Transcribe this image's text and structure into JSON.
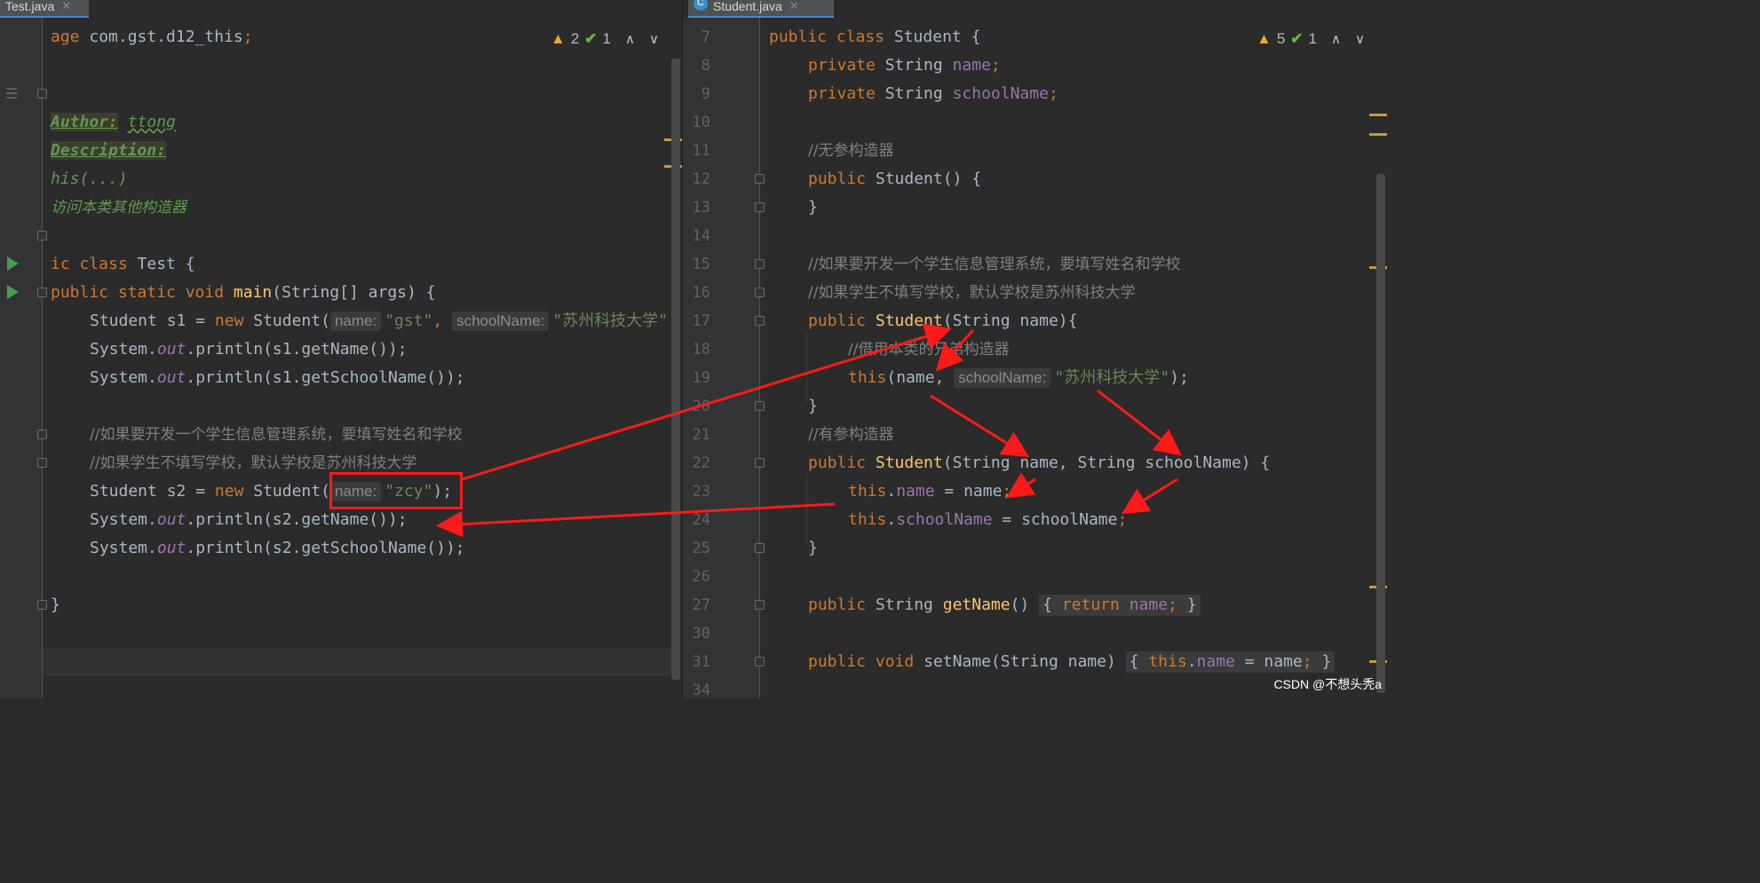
{
  "tabs": {
    "left": {
      "label": "Test.java"
    },
    "right": {
      "label": "Student.java",
      "icon": "C"
    }
  },
  "left_editor": {
    "indicators": {
      "warnings": "2",
      "checks": "1"
    },
    "lines": {
      "pkg_kw": "age",
      "pkg_rest": " com.gst.d12_this",
      "semi": ";",
      "author_tag": "Author:",
      "author_val": "ttong",
      "desc_tag": "Description:",
      "doc_this": "his(...)",
      "doc_cn": "访问本类其他构造器",
      "class_kw": "ic class",
      "class_name": " Test {",
      "main_kw": "public static void",
      "main_fn": "main",
      "main_args": "(String[] args) {",
      "s1_decl": "Student s1 = ",
      "new_kw": "new",
      "student_call": " Student(",
      "hint_name": "name:",
      "str_gst": "\"gst\"",
      "comma": ",",
      "hint_school": "schoolName:",
      "str_suzhou": "\"苏州科技大学\"",
      "sys1a": "System.",
      "out": "out",
      "println_s1_name": ".println(s1.getName());",
      "println_s1_school": ".println(s1.getSchoolName());",
      "cmt1": "//如果要开发一个学生信息管理系统，要填写姓名和学校",
      "cmt2": "//如果学生不填写学校，默认学校是苏州科技大学",
      "s2_decl": "Student s2 = ",
      "str_zcy": "\"zcy\"",
      "close_paren": ");",
      "println_s2_name": ".println(s2.getName());",
      "println_s2_school": ".println(s2.getSchoolName());",
      "close_brace": "}"
    }
  },
  "right_editor": {
    "indicators": {
      "warnings": "5",
      "checks": "1"
    },
    "line_numbers": [
      "7",
      "8",
      "9",
      "10",
      "11",
      "12",
      "13",
      "14",
      "15",
      "16",
      "17",
      "18",
      "19",
      "20",
      "21",
      "22",
      "23",
      "24",
      "25",
      "26",
      "27",
      "30",
      "31",
      "34"
    ],
    "lines": {
      "l7_kw": "public class",
      "l7_rest": " Student {",
      "l8_kw": "private",
      "l8_type": " String ",
      "l8_fld": "name",
      "l9_fld": "schoolName",
      "l11": "//无参构造器",
      "l12_kw": "public",
      "l12_rest": " Student() {",
      "l13": "}",
      "l15": "//如果要开发一个学生信息管理系统，要填写姓名和学校",
      "l16": "//如果学生不填写学校，默认学校是苏州科技大学",
      "l17_fn": "Student",
      "l17_rest": "(String name){",
      "l18": "//借用本类的兄弟构造器",
      "l19_kw": "this",
      "l19_rest": "(name,",
      "l19_str": "\"苏州科技大学\"",
      "l19_end": ");",
      "l21": "//有参构造器",
      "l22_rest": "(String name, String schoolName) {",
      "l23_eq": " = name",
      "l24_eq": " = schoolName",
      "l27_kw": "public",
      "l27_type": " String ",
      "l27_fn": "getName",
      "l27_parens": "()",
      "l27_return": "return",
      "l27_open": "{",
      "l27_close": "}",
      "l31_void": " void ",
      "l31_fn": "setName",
      "l31_args": "(String name)",
      "l31_this": "this",
      "dot": ".",
      "l31_eq": " = name"
    }
  },
  "watermark": "CSDN @不想头秃a",
  "colors": {
    "annotation": "#ff1a1a",
    "keyword": "#cc7832",
    "function": "#ffc66d",
    "string": "#6a8759",
    "comment": "#808080",
    "field": "#9876aa"
  }
}
